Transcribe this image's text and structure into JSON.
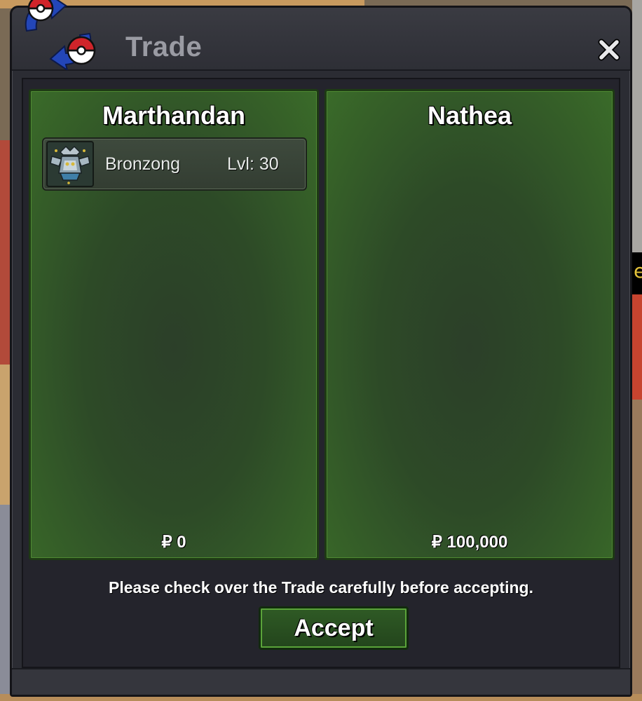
{
  "window": {
    "title": "Trade",
    "close_icon": "close-icon",
    "logo_icon": "trade-exchange-icon"
  },
  "left_panel": {
    "player_name": "Marthandan",
    "items": [
      {
        "name": "Bronzong",
        "level": "Lvl: 30",
        "icon": "bronzong-sprite-icon"
      }
    ],
    "money": "₽ 0"
  },
  "right_panel": {
    "player_name": "Nathea",
    "items": [],
    "money": "₽ 100,000"
  },
  "notice": "Please check over the Trade carefully before accepting.",
  "accept_label": "Accept",
  "edge_text": "e",
  "colors": {
    "panel_green": "#2d4a27",
    "panel_border": "#4f8a33",
    "window_bg": "#2b2c33",
    "title_gray": "#9a9ba3",
    "pokeball_red": "#d0242a",
    "arrow_blue": "#2346b8"
  }
}
